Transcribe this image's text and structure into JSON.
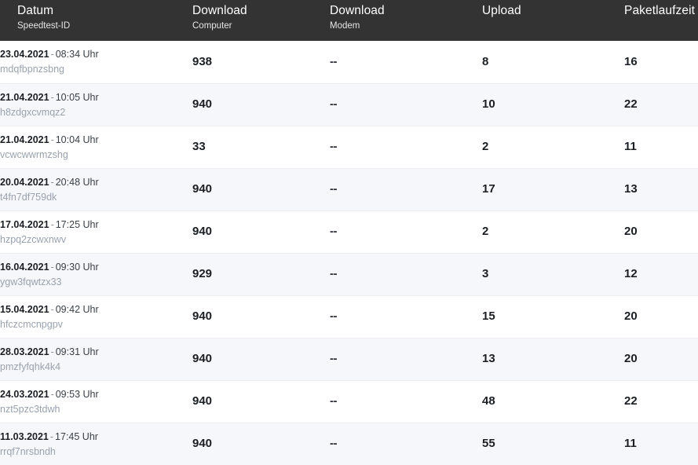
{
  "table": {
    "columns": [
      {
        "title": "Datum",
        "subtitle": "Speedtest-ID"
      },
      {
        "title": "Download",
        "subtitle": "Computer"
      },
      {
        "title": "Download",
        "subtitle": "Modem"
      },
      {
        "title": "Upload",
        "subtitle": ""
      },
      {
        "title": "Paketlaufzeit",
        "subtitle": ""
      }
    ],
    "rows": [
      {
        "date": "23.04.2021",
        "separator": "-",
        "time": "08:34 Uhr",
        "id": "mdqfbpnzsbng",
        "download_computer": "938",
        "download_modem": "--",
        "upload": "8",
        "paketlaufzeit": "16"
      },
      {
        "date": "21.04.2021",
        "separator": "-",
        "time": "10:05 Uhr",
        "id": "h8zdgxcvmqz2",
        "download_computer": "940",
        "download_modem": "--",
        "upload": "10",
        "paketlaufzeit": "22"
      },
      {
        "date": "21.04.2021",
        "separator": "-",
        "time": "10:04 Uhr",
        "id": "vcwcwwrmzshg",
        "download_computer": "33",
        "download_modem": "--",
        "upload": "2",
        "paketlaufzeit": "11"
      },
      {
        "date": "20.04.2021",
        "separator": "-",
        "time": "20:48 Uhr",
        "id": "t4fn7df759dk",
        "download_computer": "940",
        "download_modem": "--",
        "upload": "17",
        "paketlaufzeit": "13"
      },
      {
        "date": "17.04.2021",
        "separator": "-",
        "time": "17:25 Uhr",
        "id": "hzpq2zcwxnwv",
        "download_computer": "940",
        "download_modem": "--",
        "upload": "2",
        "paketlaufzeit": "20"
      },
      {
        "date": "16.04.2021",
        "separator": "-",
        "time": "09:30 Uhr",
        "id": "ygw3fqwtzx33",
        "download_computer": "929",
        "download_modem": "--",
        "upload": "3",
        "paketlaufzeit": "12"
      },
      {
        "date": "15.04.2021",
        "separator": "-",
        "time": "09:42 Uhr",
        "id": "hfczcmcnpgpv",
        "download_computer": "940",
        "download_modem": "--",
        "upload": "15",
        "paketlaufzeit": "20"
      },
      {
        "date": "28.03.2021",
        "separator": "-",
        "time": "09:31 Uhr",
        "id": "pmzfyfqhk4k4",
        "download_computer": "940",
        "download_modem": "--",
        "upload": "13",
        "paketlaufzeit": "20"
      },
      {
        "date": "24.03.2021",
        "separator": "-",
        "time": "09:53 Uhr",
        "id": "nzt5pzc3tdwh",
        "download_computer": "940",
        "download_modem": "--",
        "upload": "48",
        "paketlaufzeit": "22"
      },
      {
        "date": "11.03.2021",
        "separator": "-",
        "time": "17:45 Uhr",
        "id": "rrqf7nrsbndh",
        "download_computer": "940",
        "download_modem": "--",
        "upload": "55",
        "paketlaufzeit": "11"
      }
    ]
  },
  "colors": {
    "header_background": "#333333",
    "header_text": "#ffffff",
    "row_background": "#ffffff",
    "row_background_alt": "#f5f7fb",
    "value_text": "#1b1f24",
    "id_text": "#9aa2ad"
  }
}
